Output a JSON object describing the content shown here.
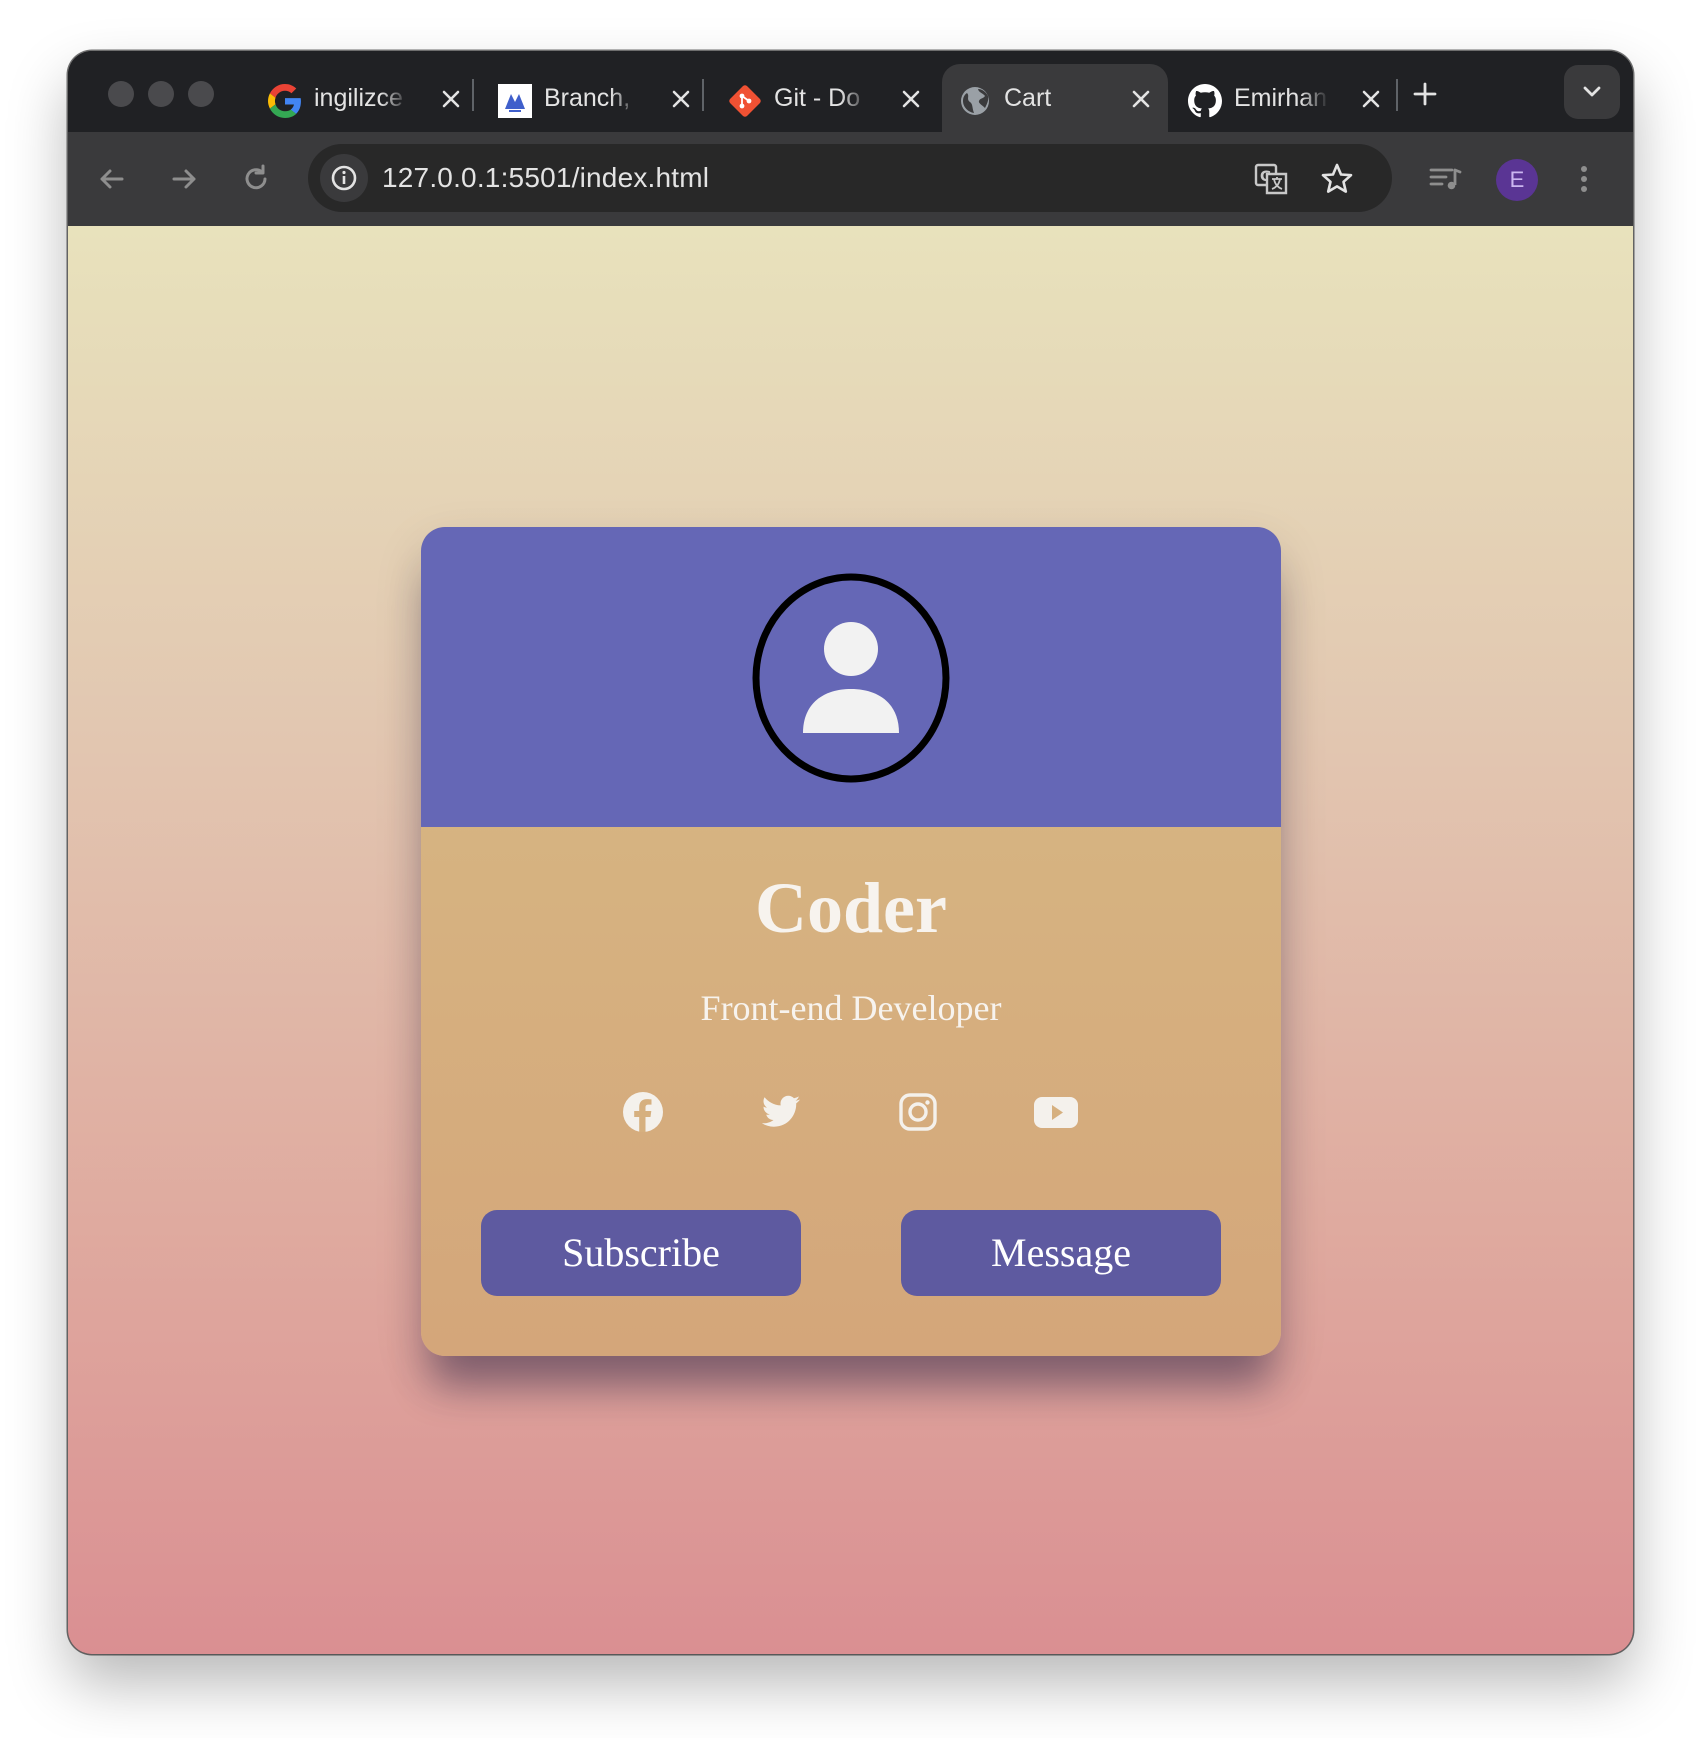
{
  "browser": {
    "tabs": [
      {
        "title": "ingilizce",
        "favicon": "google-icon",
        "active": false
      },
      {
        "title": "Branch,",
        "favicon": "atlassian-icon",
        "active": false
      },
      {
        "title": "Git - Do",
        "favicon": "git-icon",
        "active": false
      },
      {
        "title": "Cart",
        "favicon": "globe-icon",
        "active": true
      },
      {
        "title": "Emirhan",
        "favicon": "github-icon",
        "active": false
      }
    ],
    "url": "127.0.0.1:5501/index.html",
    "profile_initial": "E"
  },
  "card": {
    "name": "Coder",
    "role": "Front-end Developer",
    "social_icons": [
      "facebook-icon",
      "twitter-icon",
      "instagram-icon",
      "youtube-icon"
    ],
    "buttons": {
      "subscribe": "Subscribe",
      "message": "Message"
    }
  },
  "colors": {
    "card_header": "#6567b6",
    "card_body": "#d6b07f",
    "button": "#5e5aa0",
    "page_gradient_top": "#e8e2bc",
    "page_gradient_bottom": "#da8f92"
  }
}
